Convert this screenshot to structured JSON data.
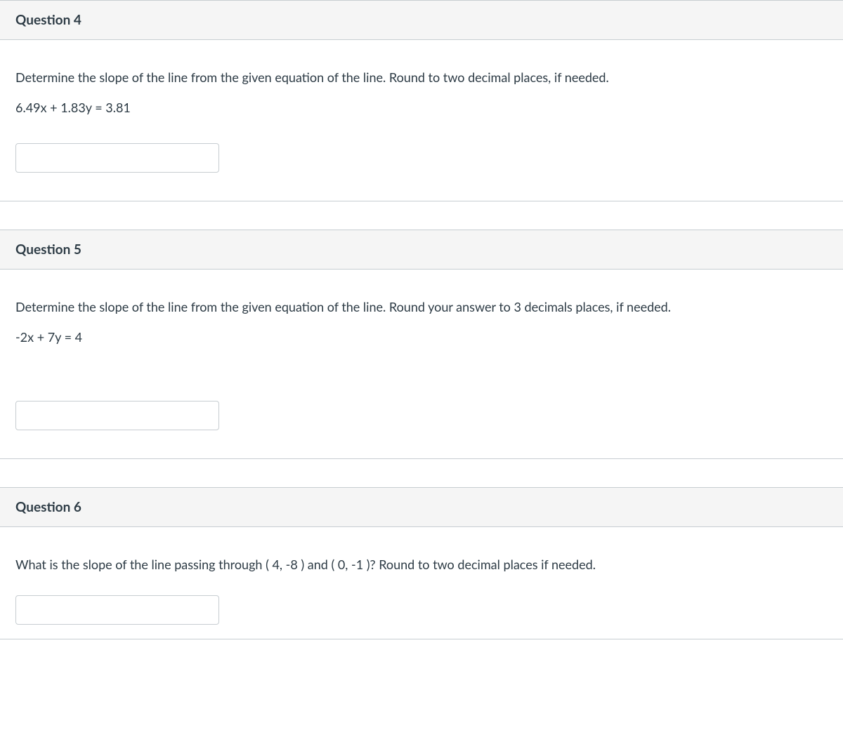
{
  "questions": [
    {
      "title": "Question 4",
      "prompt": "Determine the slope of the line from the given equation of the line. Round to two decimal places, if needed.",
      "equation": "6.49x + 1.83y = 3.81",
      "answer": ""
    },
    {
      "title": "Question 5",
      "prompt": "Determine the slope of the line from the given equation of the line. Round your answer to 3 decimals places, if needed.",
      "equation": "-2x + 7y = 4",
      "answer": ""
    },
    {
      "title": "Question 6",
      "prompt": "What is the slope of the line passing through ( 4, -8 ) and ( 0, -1 )?  Round to two decimal places if needed.",
      "equation": "",
      "answer": ""
    }
  ]
}
